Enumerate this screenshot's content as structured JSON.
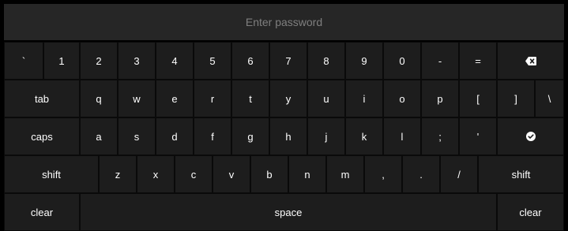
{
  "password_field": {
    "placeholder": "Enter password",
    "value": ""
  },
  "keyboard": {
    "rows": [
      [
        {
          "name": "key-backtick",
          "label": "`"
        },
        {
          "name": "key-1",
          "label": "1"
        },
        {
          "name": "key-2",
          "label": "2"
        },
        {
          "name": "key-3",
          "label": "3"
        },
        {
          "name": "key-4",
          "label": "4"
        },
        {
          "name": "key-5",
          "label": "5"
        },
        {
          "name": "key-6",
          "label": "6"
        },
        {
          "name": "key-7",
          "label": "7"
        },
        {
          "name": "key-8",
          "label": "8"
        },
        {
          "name": "key-9",
          "label": "9"
        },
        {
          "name": "key-0",
          "label": "0"
        },
        {
          "name": "key-minus",
          "label": "-"
        },
        {
          "name": "key-equals",
          "label": "="
        },
        {
          "name": "backspace-key",
          "icon": "backspace-icon"
        }
      ],
      [
        {
          "name": "tab-key",
          "label": "tab"
        },
        {
          "name": "key-q",
          "label": "q"
        },
        {
          "name": "key-w",
          "label": "w"
        },
        {
          "name": "key-e",
          "label": "e"
        },
        {
          "name": "key-r",
          "label": "r"
        },
        {
          "name": "key-t",
          "label": "t"
        },
        {
          "name": "key-y",
          "label": "y"
        },
        {
          "name": "key-u",
          "label": "u"
        },
        {
          "name": "key-i",
          "label": "i"
        },
        {
          "name": "key-o",
          "label": "o"
        },
        {
          "name": "key-p",
          "label": "p"
        },
        {
          "name": "key-left-bracket",
          "label": "["
        },
        {
          "name": "key-right-bracket",
          "label": "]"
        },
        {
          "name": "key-backslash",
          "label": "\\"
        }
      ],
      [
        {
          "name": "caps-key",
          "label": "caps"
        },
        {
          "name": "key-a",
          "label": "a"
        },
        {
          "name": "key-s",
          "label": "s"
        },
        {
          "name": "key-d",
          "label": "d"
        },
        {
          "name": "key-f",
          "label": "f"
        },
        {
          "name": "key-g",
          "label": "g"
        },
        {
          "name": "key-h",
          "label": "h"
        },
        {
          "name": "key-j",
          "label": "j"
        },
        {
          "name": "key-k",
          "label": "k"
        },
        {
          "name": "key-l",
          "label": "l"
        },
        {
          "name": "key-semicolon",
          "label": ";"
        },
        {
          "name": "key-quote",
          "label": "'"
        },
        {
          "name": "enter-key",
          "icon": "check-circle-icon"
        }
      ],
      [
        {
          "name": "left-shift-key",
          "label": "shift"
        },
        {
          "name": "key-z",
          "label": "z"
        },
        {
          "name": "key-x",
          "label": "x"
        },
        {
          "name": "key-c",
          "label": "c"
        },
        {
          "name": "key-v",
          "label": "v"
        },
        {
          "name": "key-b",
          "label": "b"
        },
        {
          "name": "key-n",
          "label": "n"
        },
        {
          "name": "key-m",
          "label": "m"
        },
        {
          "name": "key-comma",
          "label": ","
        },
        {
          "name": "key-period",
          "label": "."
        },
        {
          "name": "key-slash",
          "label": "/"
        },
        {
          "name": "right-shift-key",
          "label": "shift"
        }
      ],
      [
        {
          "name": "left-clear-key",
          "label": "clear"
        },
        {
          "name": "space-key",
          "label": "space"
        },
        {
          "name": "right-clear-key",
          "label": "clear"
        }
      ]
    ]
  }
}
